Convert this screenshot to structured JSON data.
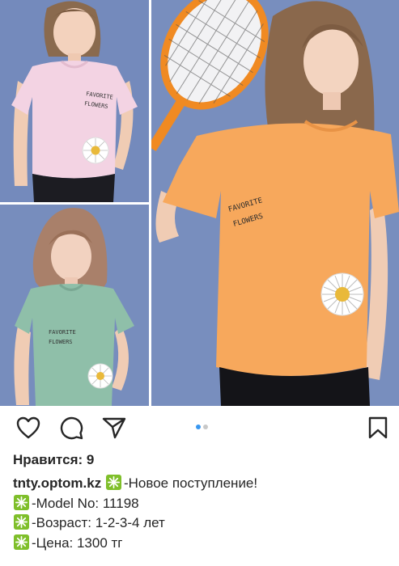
{
  "post": {
    "likes_text": "Нравится: 9",
    "username": "tnty.optom.kz",
    "caption_lines": [
      "-Новое поступление!",
      "-Model No: 11198",
      "-Возраст: 1-2-3-4 лет",
      "-Цена: 1300 тг"
    ]
  },
  "carousel": {
    "current": 1,
    "total": 2
  },
  "photo_texts": {
    "shirt_print_line1": "FAVORITE",
    "shirt_print_line2": "FLOWERS"
  },
  "colors": {
    "accent_dot": "#3897f0",
    "inactive_dot": "#c8c8c8",
    "emoji_green": "#7fbf2a",
    "background_blue": "#6f86b8",
    "shirt_pink": "#f3d3e3",
    "shirt_mint": "#8fbfa9",
    "shirt_orange": "#f7a85c"
  },
  "icons": [
    "heart-icon",
    "comment-icon",
    "share-icon",
    "bookmark-icon",
    "sparkle-emoji-icon"
  ]
}
